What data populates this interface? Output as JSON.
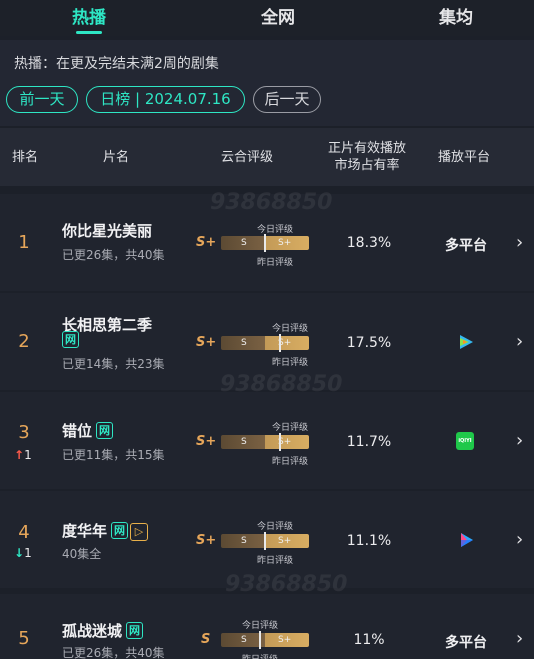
{
  "tabs": [
    "热播",
    "全网",
    "集均"
  ],
  "info": {
    "desc": "热播：在更及完结未满2周的剧集",
    "prev": "前一天",
    "date": "日榜 | 2024.07.16",
    "next": "后一天"
  },
  "headers": {
    "rank": "排名",
    "title": "片名",
    "rating": "云合评级",
    "share_line1": "正片有效播放",
    "share_line2": "市场占有率",
    "platform": "播放平台"
  },
  "bar_labels": {
    "top": "今日评级",
    "bottom": "昨日评级",
    "left": "S",
    "right": "S+"
  },
  "rows": [
    {
      "rank": "1",
      "title": "你比星光美丽",
      "badge": "",
      "extra_badge": "",
      "sub": "已更26集，共40集",
      "grade": "S+",
      "share": "18.3%",
      "platform": "多平台",
      "platform_icon": "",
      "trend": "",
      "trend_dir": ""
    },
    {
      "rank": "2",
      "title": "长相思第二季",
      "badge": "网",
      "extra_badge": "",
      "sub": "已更14集，共23集",
      "grade": "S+",
      "share": "17.5%",
      "platform": "",
      "platform_icon": "tencent-video-icon",
      "trend": "",
      "trend_dir": ""
    },
    {
      "rank": "3",
      "title": "错位",
      "badge": "网",
      "extra_badge": "",
      "sub": "已更11集，共15集",
      "grade": "S+",
      "share": "11.7%",
      "platform": "",
      "platform_icon": "iqiyi-icon",
      "trend": "1",
      "trend_dir": "up"
    },
    {
      "rank": "4",
      "title": "度华年",
      "badge": "网",
      "extra_badge": "▷",
      "sub": "40集全",
      "grade": "S+",
      "share": "11.1%",
      "platform": "",
      "platform_icon": "youku-icon",
      "trend": "1",
      "trend_dir": "down"
    },
    {
      "rank": "5",
      "title": "孤战迷城",
      "badge": "网",
      "extra_badge": "",
      "sub": "已更26集，共40集",
      "grade": "S",
      "share": "11%",
      "platform": "多平台",
      "platform_icon": "",
      "trend": "",
      "trend_dir": ""
    }
  ],
  "colors": {
    "accent": "#2ee6c4",
    "rank": "#e6a65a",
    "up": "#ff5a4a",
    "down": "#2ee6c4"
  },
  "watermark": "93868850"
}
